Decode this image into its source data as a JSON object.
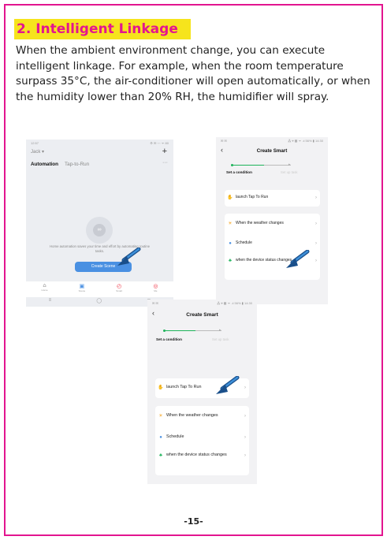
{
  "section": {
    "title": "2. Intelligent Linkage",
    "paragraph": "When the ambient environment change, you can execute intelligent linkage. For example, when the room temperature surpass 35°C, the air-conditioner will open automatically, or when the humidity lower than 20% RH, the humidifier will spray."
  },
  "screen1": {
    "status_left": "12:57",
    "status_right": "⚙ ✉ ◦◦◦ ᯤ 80",
    "user": "Jack ▾",
    "plus": "+",
    "tab_active": "Automation",
    "tab_other": "Tap-to-Run",
    "more": "···",
    "empty_text": "Home automation saves your time and effort by automating routine tasks.",
    "create_button": "Create Scene",
    "tabs": [
      {
        "label": "Home",
        "icon": "⌂"
      },
      {
        "label": "Scene",
        "icon": "▣"
      },
      {
        "label": "Smart",
        "icon": "◴"
      },
      {
        "label": "Me",
        "icon": "◎"
      }
    ],
    "nav": [
      "≡",
      "◯",
      "⊐"
    ]
  },
  "screen2": {
    "status_left": "✉ ✉",
    "status_right": "⁂ ⌖ ▩ ᯤ .ıl 56% ▮ 14:30",
    "back": "‹",
    "title": "Create Smart",
    "step1": "Set a condition",
    "step2": "Set up task",
    "rows": [
      {
        "icon": "✋",
        "label": "launch Tap To Run",
        "chevron": "›"
      },
      {
        "icon": "☀",
        "label": "When the weather changes",
        "chevron": "›"
      },
      {
        "icon": "●",
        "label": "Schedule",
        "chevron": "›"
      },
      {
        "icon": "♣",
        "label": "when the device status changes",
        "chevron": "›"
      }
    ]
  },
  "screen3": {
    "status_left": "✉ ✉",
    "status_right": "⁂ ⌖ ▩ ᯤ .ıl 56% ▮ 14:30",
    "back": "‹",
    "title": "Create Smart",
    "step1": "Set a condition",
    "step2": "Set up task",
    "rows": [
      {
        "icon": "✋",
        "label": "launch Tap To Run",
        "chevron": "›"
      },
      {
        "icon": "☀",
        "label": "When the weather changes",
        "chevron": "›"
      },
      {
        "icon": "●",
        "label": "Schedule",
        "chevron": "›"
      },
      {
        "icon": "♣",
        "label": "when the device status changes",
        "chevron": "›"
      }
    ]
  },
  "footer": {
    "page_number": "-15-"
  },
  "colors": {
    "border": "#e3158f",
    "title_bg": "#f6e41c",
    "title_text": "#e3158f",
    "accent_blue": "#4a90e2",
    "accent_green": "#1db35a"
  }
}
